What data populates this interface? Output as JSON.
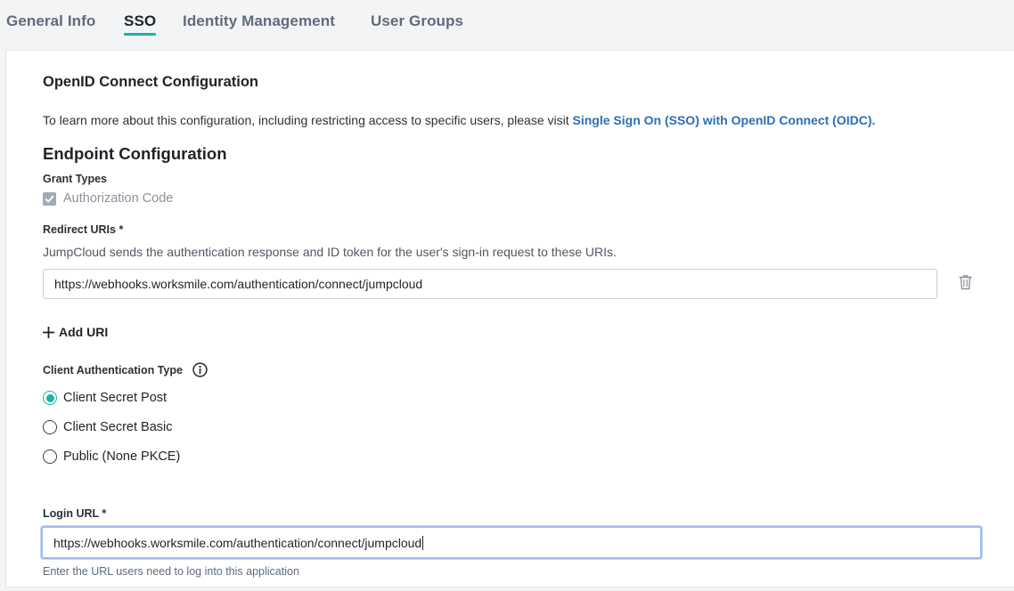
{
  "tabs": [
    {
      "label": "General Info"
    },
    {
      "label": "SSO"
    },
    {
      "label": "Identity Management"
    },
    {
      "label": "User Groups"
    }
  ],
  "oidc": {
    "title": "OpenID Connect Configuration",
    "intro_text": "To learn more about this configuration, including restricting access to specific users, please visit ",
    "intro_link": "Single Sign On (SSO) with OpenID Connect (OIDC)."
  },
  "endpoint": {
    "title": "Endpoint Configuration",
    "grant_types_label": "Grant Types",
    "grant_type_option": "Authorization Code",
    "redirect_label": "Redirect URIs *",
    "redirect_help": "JumpCloud sends the authentication response and ID token for the user's sign-in request to these URIs.",
    "redirect_value": "https://webhooks.worksmile.com/authentication/connect/jumpcloud",
    "add_uri_label": "Add URI",
    "client_auth_label": "Client Authentication Type",
    "client_auth_options": [
      {
        "label": "Client Secret Post",
        "checked": true
      },
      {
        "label": "Client Secret Basic",
        "checked": false
      },
      {
        "label": "Public (None PKCE)",
        "checked": false
      }
    ],
    "login_label": "Login URL *",
    "login_value": "https://webhooks.worksmile.com/authentication/connect/jumpcloud",
    "login_hint": "Enter the URL users need to log into this application"
  },
  "colors": {
    "accent": "#1ab3a6",
    "link": "#2d6fb2",
    "focus_ring": "#9dbce8"
  }
}
